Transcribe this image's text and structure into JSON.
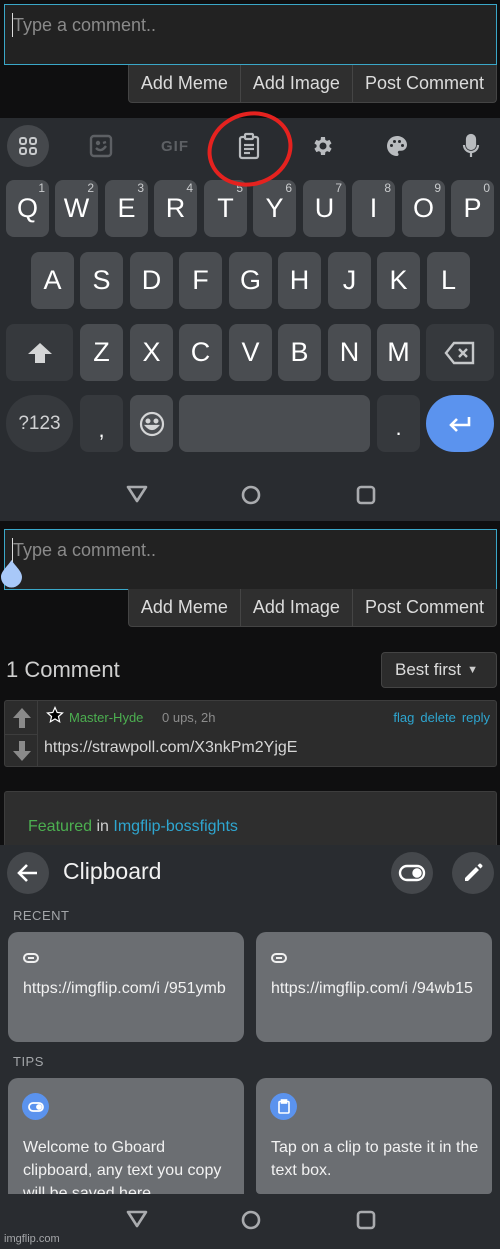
{
  "comment_form": {
    "placeholder": "Type a comment..",
    "buttons": [
      "Add Meme",
      "Add Image",
      "Post Comment"
    ]
  },
  "keyboard": {
    "toolbar": [
      "apps-grid",
      "sticker",
      "GIF",
      "clipboard",
      "settings",
      "theme-palette",
      "microphone"
    ],
    "gif_label": "GIF",
    "rows": [
      [
        {
          "k": "Q",
          "h": "1"
        },
        {
          "k": "W",
          "h": "2"
        },
        {
          "k": "E",
          "h": "3"
        },
        {
          "k": "R",
          "h": "4"
        },
        {
          "k": "T",
          "h": "5"
        },
        {
          "k": "Y",
          "h": "6"
        },
        {
          "k": "U",
          "h": "7"
        },
        {
          "k": "I",
          "h": "8"
        },
        {
          "k": "O",
          "h": "9"
        },
        {
          "k": "P",
          "h": "0"
        }
      ],
      [
        {
          "k": "A"
        },
        {
          "k": "S"
        },
        {
          "k": "D"
        },
        {
          "k": "F"
        },
        {
          "k": "G"
        },
        {
          "k": "H"
        },
        {
          "k": "J"
        },
        {
          "k": "K"
        },
        {
          "k": "L"
        }
      ],
      [
        {
          "k": "Z"
        },
        {
          "k": "X"
        },
        {
          "k": "C"
        },
        {
          "k": "V"
        },
        {
          "k": "B"
        },
        {
          "k": "N"
        },
        {
          "k": "M"
        }
      ]
    ],
    "symbols_label": "?123",
    "comma": ",",
    "period": ".",
    "highlight_color": "#e5221f",
    "enter_color": "#5b93ee"
  },
  "comments": {
    "count_label": "1 Comment",
    "sort_label": "Best first",
    "items": [
      {
        "user": "Master-Hyde",
        "meta": "0 ups, 2h",
        "actions": [
          "flag",
          "delete",
          "reply"
        ],
        "text": "https://strawpoll.com/X3nkPm2YjgE"
      }
    ],
    "featured_prefix": "Featured",
    "featured_in": "in",
    "featured_link": "Imgflip-bossfights"
  },
  "clipboard": {
    "title": "Clipboard",
    "recent_label": "RECENT",
    "recent": [
      {
        "text": "https://imgflip.com/i /951ymb"
      },
      {
        "text": "https://imgflip.com/i /94wb15"
      }
    ],
    "tips_label": "TIPS",
    "tips": [
      {
        "icon": "toggle-icon",
        "text": "Welcome to Gboard clipboard, any text you copy will be saved here."
      },
      {
        "icon": "clipboard-icon",
        "text": "Tap on a clip to paste it in the text box."
      }
    ]
  },
  "watermark": "imgflip.com"
}
